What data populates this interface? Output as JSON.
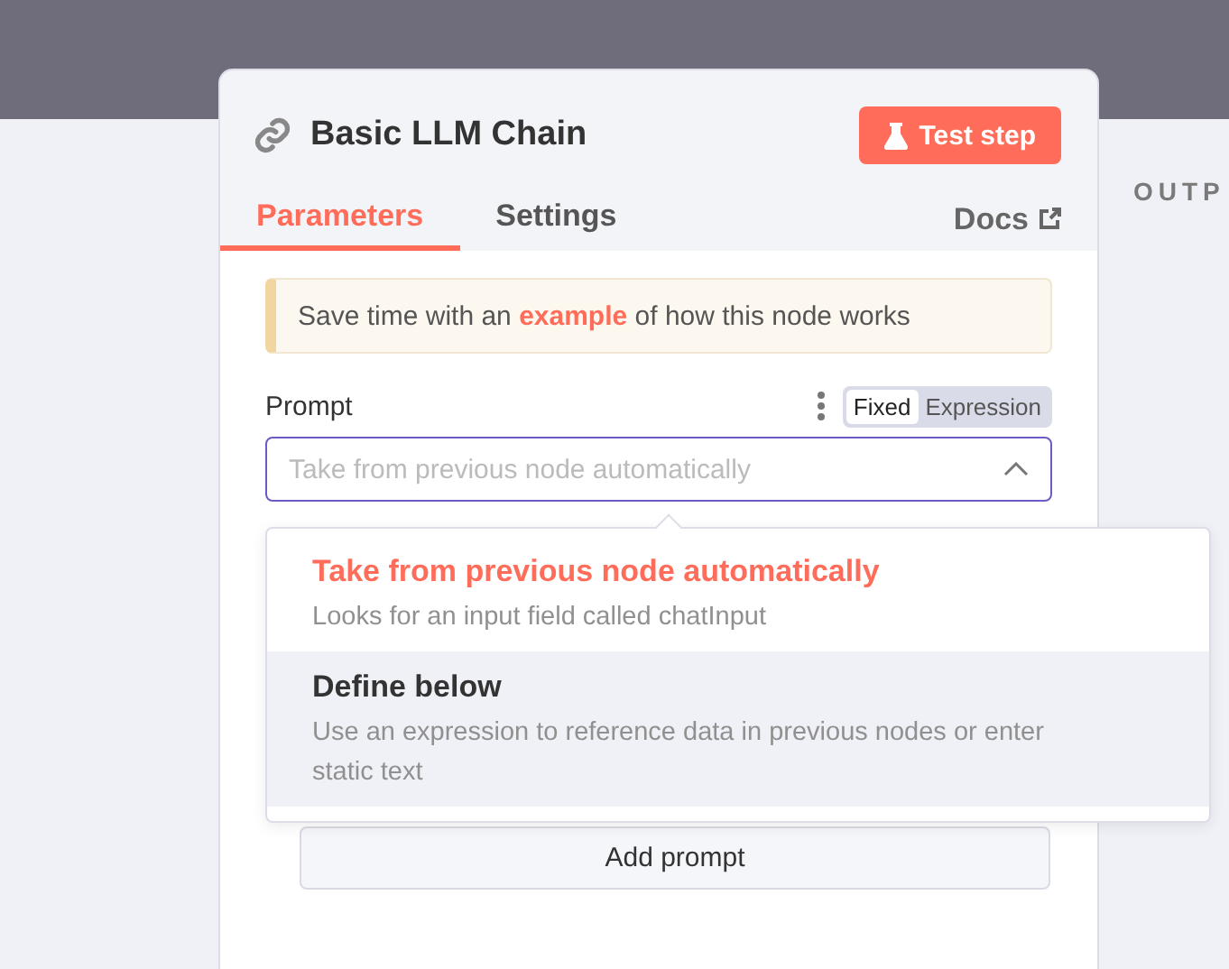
{
  "node": {
    "title": "Basic LLM Chain",
    "test_button": "Test step"
  },
  "tabs": [
    {
      "label": "Parameters",
      "selected": true
    },
    {
      "label": "Settings",
      "selected": false
    }
  ],
  "docs_link": "Docs",
  "notice": {
    "before": "Save time with an",
    "link": "example",
    "after": "of how this node works"
  },
  "prompt": {
    "label": "Prompt",
    "placeholder": "Take from previous node automatically",
    "expanded": true,
    "mode_toggle": [
      {
        "label": "Fixed",
        "selected": true
      },
      {
        "label": "Expression",
        "selected": false
      }
    ]
  },
  "dropdown_options": [
    {
      "title": "Take from previous node automatically",
      "description": "Looks for an input field called chatInput",
      "selected": true,
      "highlighted": false
    },
    {
      "title": "Define below",
      "description": "Use an expression to reference data in previous nodes or enter static text",
      "selected": false,
      "highlighted": true
    }
  ],
  "add_button": "Add prompt",
  "output_heading": "OUTP"
}
